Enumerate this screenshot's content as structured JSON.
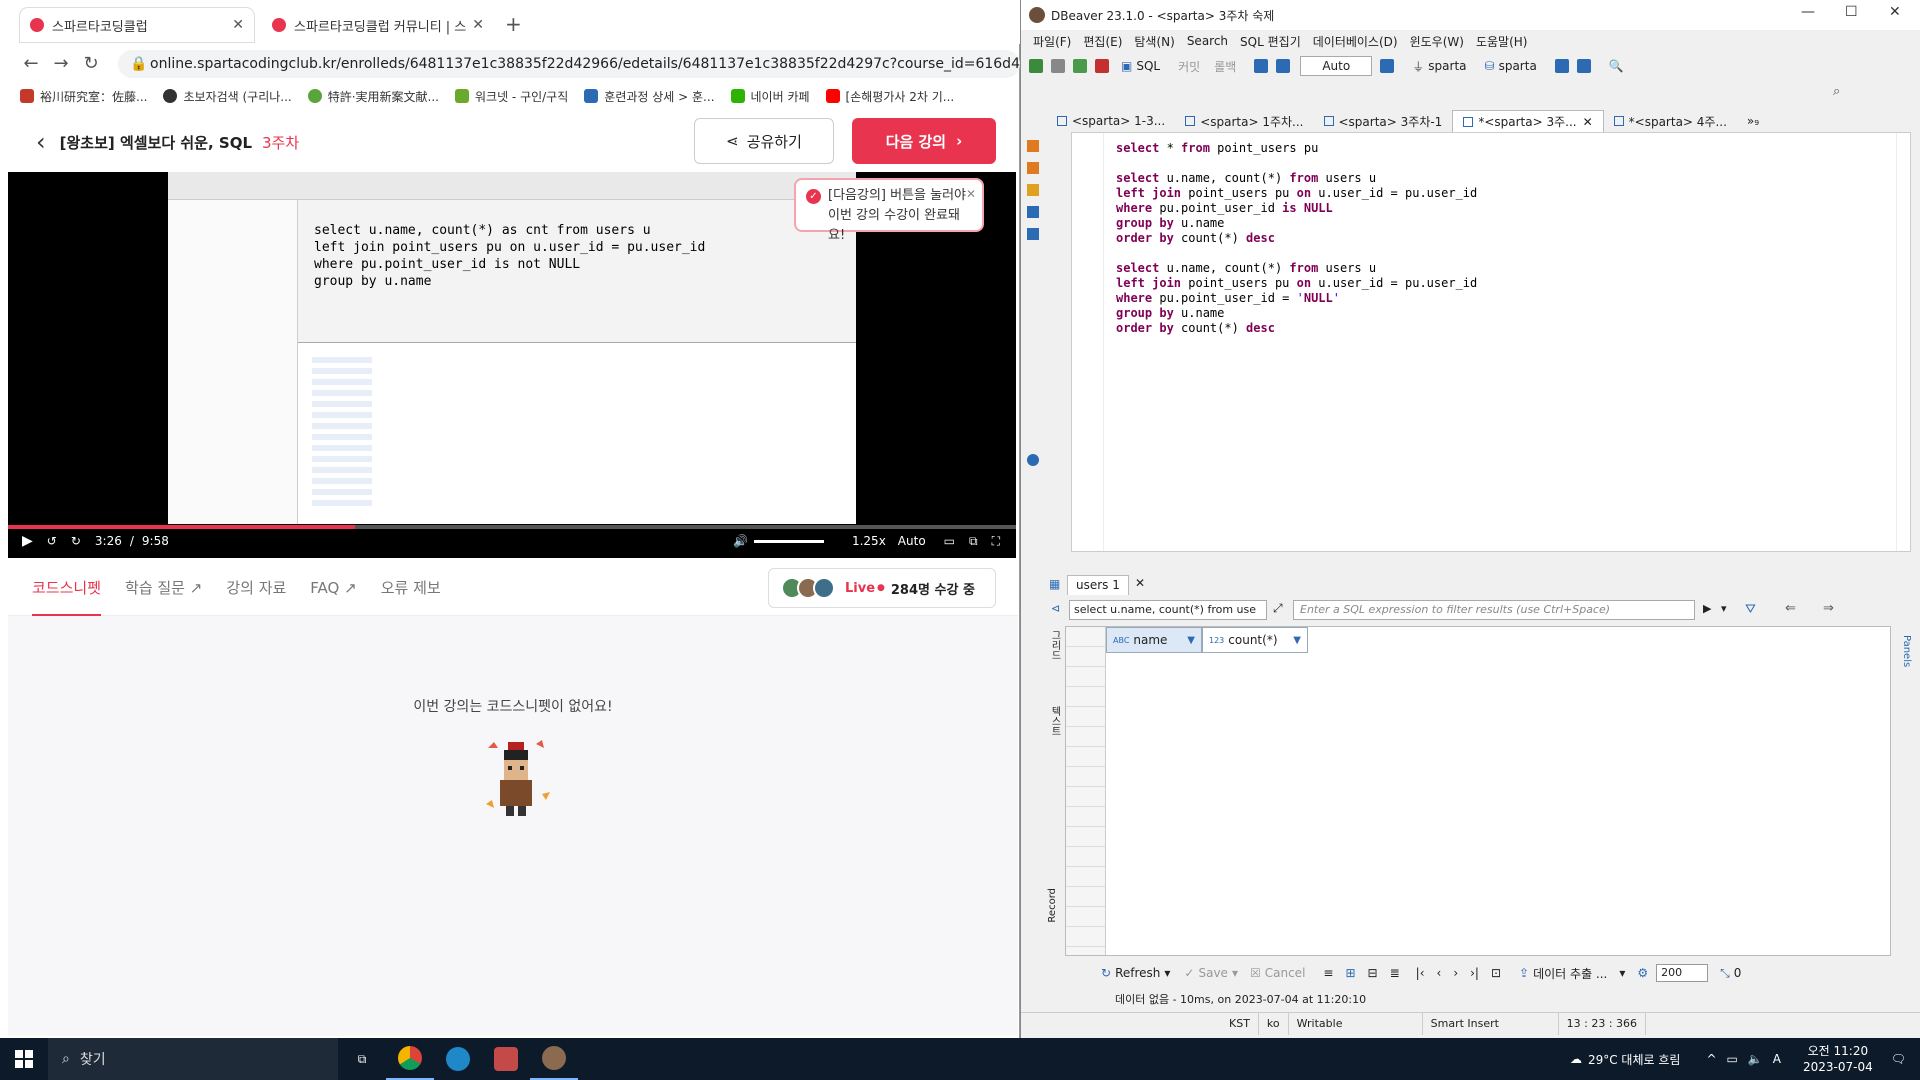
{
  "chrome": {
    "tabs": [
      {
        "title": "스파르타코딩클럽",
        "active": true
      },
      {
        "title": "스파르타코딩클럽 커뮤니티 | 스",
        "active": false
      }
    ],
    "url": "online.spartacodingclub.kr/enrolleds/6481137e1c38835f22d42966/edetails/6481137e1c38835f22d4297c?course_id=616d4349460cf1cf6f9",
    "bookmarks": [
      {
        "label": "裕川研究室：佐藤...",
        "color": "#c43a2a"
      },
      {
        "label": "초보자검색 (구리나...",
        "color": "#333333"
      },
      {
        "label": "特許·実用新案文献...",
        "color": "#58a63b"
      },
      {
        "label": "워크넷 - 구인/구직",
        "color": "#6aaa2a"
      },
      {
        "label": "훈련과정 상세 > 훈...",
        "color": "#2c6ab3"
      },
      {
        "label": "네이버 카페",
        "color": "#2db400"
      },
      {
        "label": "[손해평가사 2차 기...",
        "color": "#ff0000"
      }
    ]
  },
  "course": {
    "title": "[왕초보] 엑셀보다 쉬운, SQL",
    "week": "3주차",
    "share_label": "공유하기",
    "next_label": "다음 강의",
    "tooltip_line1": "[다음강의] 버튼을 눌러야",
    "tooltip_line2": "이번 강의 수강이 완료돼요!",
    "video": {
      "current": "3:26",
      "sep": "/",
      "total": "9:58",
      "speed": "1.25x",
      "quality": "Auto",
      "progress": 0.344,
      "code": [
        "select u.name, count(*) as cnt from users u",
        "left join point_users pu on u.user_id = pu.user_id",
        "where pu.point_user_id is not NULL",
        "group by u.name"
      ]
    },
    "tabs": [
      "코드스니펫",
      "학습 질문 ↗",
      "강의 자료",
      "FAQ ↗",
      "오류 제보"
    ],
    "live_label": "Live",
    "live_count": "284명 수강 중",
    "empty_msg": "이번 강의는 코드스니펫이 없어요!"
  },
  "dbeaver": {
    "title": "DBeaver 23.1.0 - <sparta> 3주차 숙제",
    "menu": [
      "파일(F)",
      "편집(E)",
      "탐색(N)",
      "Search",
      "SQL 편집기",
      "데이터베이스(D)",
      "윈도우(W)",
      "도움말(H)"
    ],
    "toolbar": {
      "sql": "SQL",
      "commit": "커밋",
      "rollback": "롤백",
      "auto": "Auto",
      "conn1": "sparta",
      "conn2": "sparta"
    },
    "editor_tabs": [
      "<sparta> 1-3...",
      "<sparta> 1주차...",
      "<sparta> 3주차-1",
      "*<sparta> 3주...",
      "*<sparta> 4주...",
      "»₉"
    ],
    "code": [
      {
        "t": "select * from point_users pu",
        "blank": false
      },
      {
        "t": "",
        "blank": true
      },
      {
        "t": "select u.name, count(*) from users u",
        "blank": false
      },
      {
        "t": "left join point_users pu on u.user_id = pu.user_id",
        "blank": false
      },
      {
        "t": "where pu.point_user_id is NULL",
        "blank": false
      },
      {
        "t": "group by u.name",
        "blank": false
      },
      {
        "t": "order by count(*) desc",
        "blank": false
      },
      {
        "t": "",
        "blank": true
      },
      {
        "t": "select u.name, count(*) from users u",
        "blank": false
      },
      {
        "t": "left join point_users pu on u.user_id = pu.user_id",
        "blank": false
      },
      {
        "t": "where pu.point_user_id = 'NULL'",
        "blank": false
      },
      {
        "t": "group by u.name",
        "blank": false
      },
      {
        "t": "order by count(*) desc",
        "blank": false
      }
    ],
    "results": {
      "tab": "users 1",
      "query": "select u.name, count(*) from use",
      "filter_placeholder": "Enter a SQL expression to filter results (use Ctrl+Space)",
      "columns": [
        {
          "type": "ABC",
          "name": "name"
        },
        {
          "type": "123",
          "name": "count(*)"
        }
      ],
      "side_labels": [
        "그리드",
        "텍스트",
        "Record"
      ],
      "right_label": "Panels",
      "refresh": "Refresh",
      "save": "Save",
      "cancel": "Cancel",
      "export": "데이터 추출 ...",
      "page_size": "200",
      "count": "0",
      "status": "데이터 없음 - 10ms, on 2023-07-04 at 11:20:10"
    },
    "statusbar": [
      "KST",
      "ko",
      "Writable",
      "Smart Insert",
      "13 : 23 : 366"
    ]
  },
  "taskbar": {
    "search": "찾기",
    "weather": "29°C  대체로 흐림",
    "time": "오전 11:20",
    "date": "2023-07-04"
  }
}
